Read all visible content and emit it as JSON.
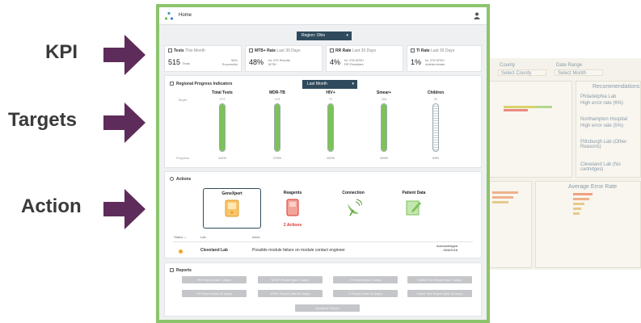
{
  "annotations": [
    {
      "label": "KPI"
    },
    {
      "label": "Targets"
    },
    {
      "label": "Action"
    }
  ],
  "colors": {
    "frame": "#8cc46c",
    "arrow": "#5e2c5a",
    "selector": "#2f4a5c",
    "fill": "#7cc259",
    "warn": "#d9342b",
    "dot": "#f2a623"
  },
  "header": {
    "home": "Home"
  },
  "region": {
    "label": "Region: Ohio"
  },
  "kpis": [
    {
      "title": "Tests",
      "period": "This Month",
      "value": "515",
      "unit": "Tests",
      "detail1": "96%",
      "detail2": "Successful"
    },
    {
      "title": "MTB+ Rate",
      "period": "Last 30 Days",
      "value": "48%",
      "detail1": "for 375 Results",
      "detail2": "MTB+"
    },
    {
      "title": "RR Rate",
      "period": "Last 30 Days",
      "value": "4%",
      "detail1": "for 378 MTB+",
      "detail2": "RR Resistant"
    },
    {
      "title": "TI Rate",
      "period": "Last 30 Days",
      "value": "1%",
      "detail1": "for 378 MTB+",
      "detail2": "Indeterminate"
    }
  ],
  "targets": {
    "title": "Regional Progress Indicators",
    "period": "Last Month",
    "row_target": "Target",
    "row_progress": "Progress",
    "items": [
      {
        "name": "Total Tests",
        "target": "574",
        "progress": "141%",
        "fill": 1.0,
        "striped": false
      },
      {
        "name": "MDR-TB",
        "target": "119",
        "progress": "170%",
        "fill": 1.0,
        "striped": false
      },
      {
        "name": "HIV+",
        "target": "72",
        "progress": "102%",
        "fill": 1.0,
        "striped": false
      },
      {
        "name": "Smear+",
        "target": "266",
        "progress": "109%",
        "fill": 1.0,
        "striped": false
      },
      {
        "name": "Children",
        "target": "32",
        "progress": "53%",
        "fill": 0.53,
        "striped": true
      }
    ]
  },
  "actions": {
    "title": "Actions",
    "items": [
      {
        "name": "GeneXpert",
        "badge": ""
      },
      {
        "name": "Reagents",
        "badge": "2 Actions"
      },
      {
        "name": "Connection",
        "badge": ""
      },
      {
        "name": "Patient Data",
        "badge": ""
      }
    ],
    "table": {
      "h_status": "Status",
      "h_lab": "Lab",
      "h_issue": "Issue",
      "row": {
        "lab": "Cleveland Lab",
        "issue": "Possible module failure on module contact engineer",
        "ack": "Acknowledged",
        "date": "28/6/2018"
      }
    }
  },
  "reports": {
    "title": "Reports",
    "buttons": [
      "RR Report (last 7 days)",
      "MTB+ Report (last 7 days)",
      "TI Report (last 7 days)",
      "Failed Test Report (last 7 days)",
      "RR Report (last 30 days)",
      "MTB+ Report (last 30 days)",
      "TI Report (last 30 days)",
      "Failed Test Report (last 30 days)",
      "Quarterly Report"
    ]
  },
  "background": {
    "county": "County",
    "date_range": "Date Range",
    "select_county": "Select County",
    "select_month": "Select Month",
    "recommendations": "Recommendations",
    "avg_error_rate": "Average Error Rate",
    "rec_items": [
      "Philadelphia Lab",
      "High error rate (6%)",
      "Northampton Hospital",
      "High error rate (5%)",
      "Pittsburgh Lab (Other Reasons)",
      "Cleveland Lab (No cartridges)"
    ]
  }
}
